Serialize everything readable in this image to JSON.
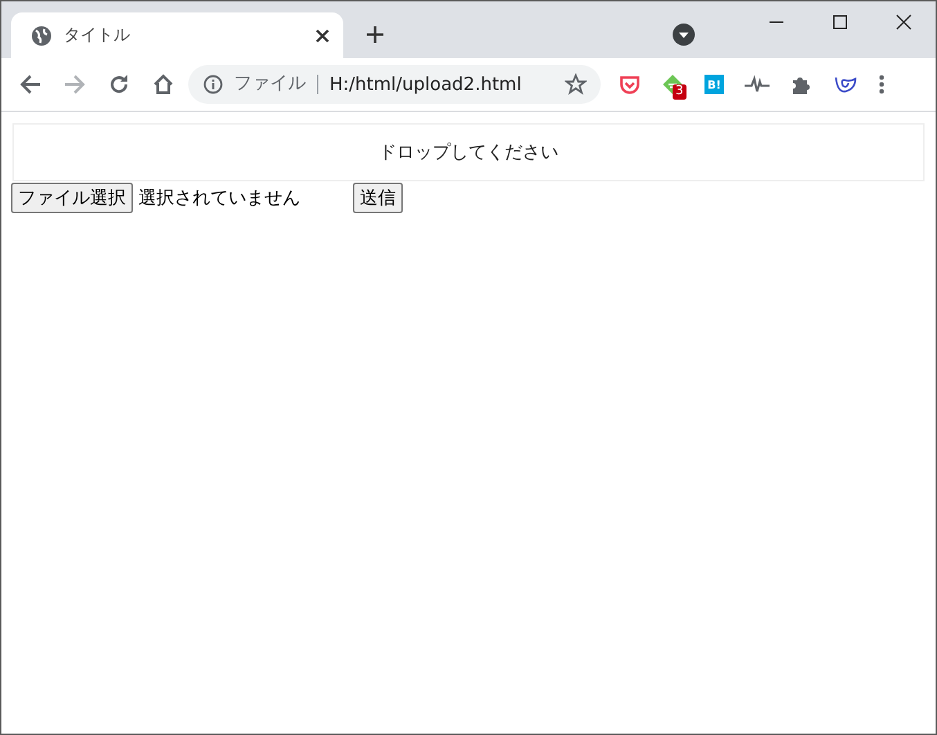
{
  "window": {
    "tab": {
      "title": "タイトル",
      "selected": true
    }
  },
  "toolbar": {
    "site_label": "ファイル",
    "url": "H:/html/upload2.html",
    "extensions": [
      {
        "kind": "pocket"
      },
      {
        "kind": "feedly",
        "badge": "3"
      },
      {
        "kind": "hatena",
        "label": "B!"
      },
      {
        "kind": "pulse"
      },
      {
        "kind": "puzzle"
      },
      {
        "kind": "swirl"
      }
    ]
  },
  "page": {
    "dropzone": "ドロップしてください",
    "file_button": "ファイル選択",
    "file_status": "選択されていません",
    "submit": "送信"
  }
}
